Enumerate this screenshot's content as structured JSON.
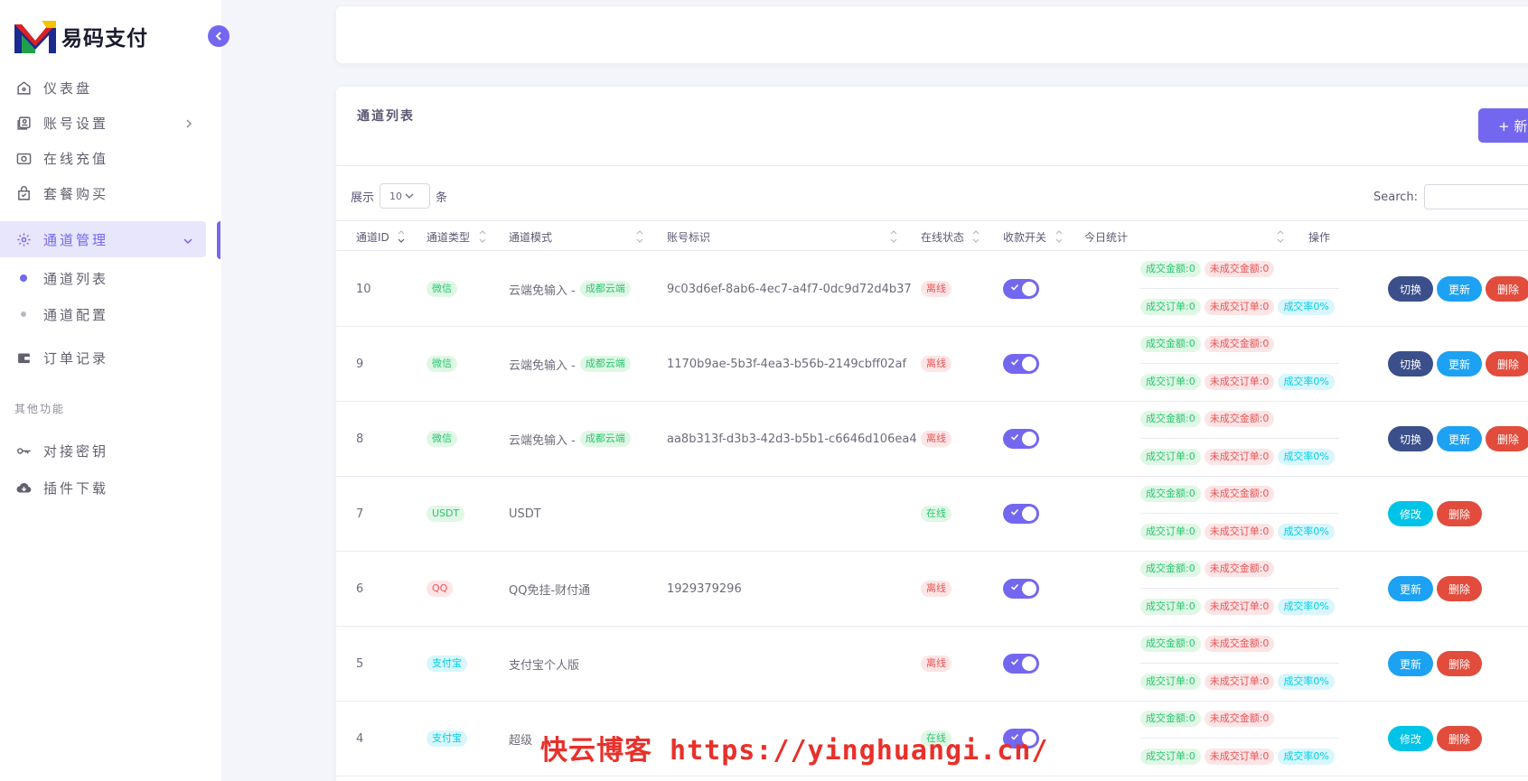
{
  "brand": {
    "name": "易码支付"
  },
  "sidebar": {
    "items": [
      {
        "label": "仪表盘",
        "icon": "home-icon"
      },
      {
        "label": "账号设置",
        "icon": "user-card-icon"
      },
      {
        "label": "在线充值",
        "icon": "camera-icon"
      },
      {
        "label": "套餐购买",
        "icon": "bag-icon"
      },
      {
        "label": "通道管理",
        "icon": "gear-icon"
      },
      {
        "label": "订单记录",
        "icon": "wallet-icon"
      }
    ],
    "sub_items": [
      {
        "label": "通道列表"
      },
      {
        "label": "通道配置"
      }
    ],
    "section_label": "其他功能",
    "other_items": [
      {
        "label": "对接密钥",
        "icon": "key-icon"
      },
      {
        "label": "插件下载",
        "icon": "cloud-download-icon"
      }
    ]
  },
  "card": {
    "title": "通道列表",
    "new_button": "+ 新",
    "show_prefix": "展示",
    "show_value": "10",
    "show_suffix": "条",
    "search_label": "Search:"
  },
  "table": {
    "headers": [
      "通道ID",
      "通道类型",
      "通道模式",
      "账号标识",
      "在线状态",
      "收款开关",
      "今日统计",
      "操作"
    ],
    "stats_labels": {
      "done_amount": "成交金额:0",
      "undone_amount": "未成交金额:0",
      "done_orders": "成交订单:0",
      "undone_orders": "未成交订单:0",
      "rate": "成交率0%"
    },
    "rows": [
      {
        "id": "10",
        "type": "微信",
        "mode": "云端免输入 -",
        "mode_badge": "成都云端",
        "account": "9c03d6ef-8ab6-4ec7-a4f7-0dc9d72d4b37",
        "status": "离线",
        "ops": [
          "切换",
          "更新",
          "删除"
        ]
      },
      {
        "id": "9",
        "type": "微信",
        "mode": "云端免输入 -",
        "mode_badge": "成都云端",
        "account": "1170b9ae-5b3f-4ea3-b56b-2149cbff02af",
        "status": "离线",
        "ops": [
          "切换",
          "更新",
          "删除"
        ]
      },
      {
        "id": "8",
        "type": "微信",
        "mode": "云端免输入 -",
        "mode_badge": "成都云端",
        "account": "aa8b313f-d3b3-42d3-b5b1-c6646d106ea4",
        "status": "离线",
        "ops": [
          "切换",
          "更新",
          "删除"
        ]
      },
      {
        "id": "7",
        "type": "USDT",
        "mode": "USDT",
        "mode_badge": "",
        "account": "",
        "status": "在线",
        "ops": [
          "修改",
          "删除"
        ]
      },
      {
        "id": "6",
        "type": "QQ",
        "mode": "QQ免挂-财付通",
        "mode_badge": "",
        "account": "1929379296",
        "status": "离线",
        "ops": [
          "更新",
          "删除"
        ]
      },
      {
        "id": "5",
        "type": "支付宝",
        "mode": "支付宝个人版",
        "mode_badge": "",
        "account": "",
        "status": "离线",
        "ops": [
          "更新",
          "删除"
        ]
      },
      {
        "id": "4",
        "type": "支付宝",
        "mode": "超级",
        "mode_badge": "",
        "account": "",
        "status": "在线",
        "ops": [
          "修改",
          "删除"
        ]
      }
    ]
  },
  "watermark": "快云博客 https://yinghuangi.cn/"
}
